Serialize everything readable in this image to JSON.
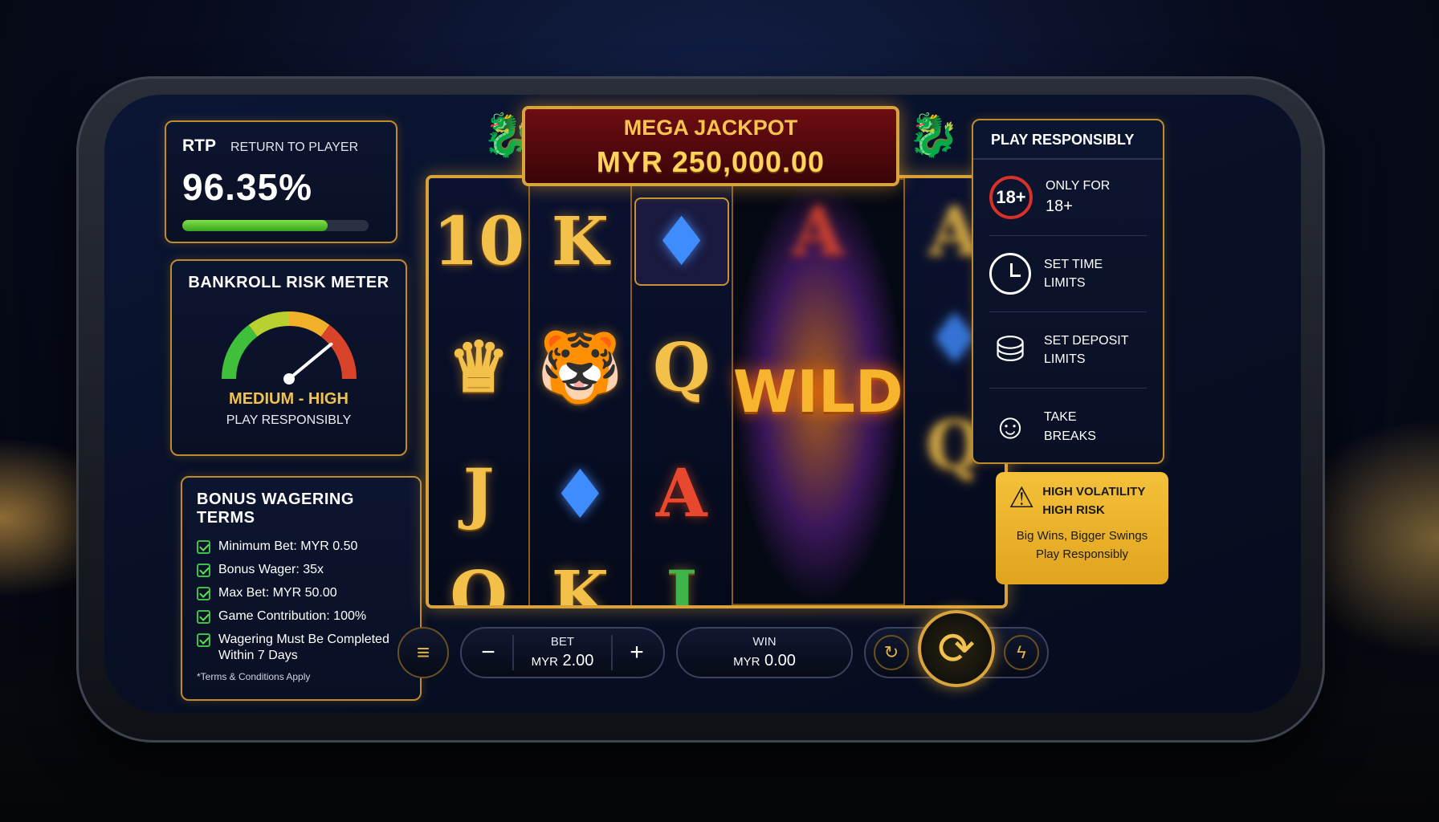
{
  "rtp": {
    "abbr": "RTP",
    "label": "RETURN TO PLAYER",
    "value": "96.35%",
    "bar_fraction": 0.78
  },
  "risk_meter": {
    "title": "BANKROLL RISK METER",
    "level": "MEDIUM - HIGH",
    "note": "PLAY RESPONSIBLY",
    "needle_fraction": 0.78
  },
  "bonus": {
    "title": "BONUS WAGERING TERMS",
    "items": [
      "Minimum Bet: MYR 0.50",
      "Bonus Wager: 35x",
      "Max Bet: MYR 50.00",
      "Game Contribution: 100%",
      "Wagering Must Be Completed Within 7 Days"
    ],
    "terms": "*Terms & Conditions Apply"
  },
  "jackpot": {
    "title": "MEGA JACKPOT",
    "amount": "MYR 250,000.00"
  },
  "reels": {
    "reel1": [
      "10",
      "crown-icon",
      "J",
      "Q"
    ],
    "reel2": [
      "K",
      "tiger-icon",
      "diamond-icon",
      "K"
    ],
    "reel3": [
      "diamond-icon",
      "Q",
      "A",
      "J"
    ],
    "reel4": [
      "A",
      "WILD"
    ],
    "reel5": [
      "A",
      "diamond-icon",
      "Q"
    ]
  },
  "controls": {
    "bet_label": "BET",
    "bet_currency": "MYR",
    "bet_value": "2.00",
    "win_label": "WIN",
    "win_currency": "MYR",
    "win_value": "0.00",
    "minus": "−",
    "plus": "+"
  },
  "responsible": {
    "title": "PLAY RESPONSIBLY",
    "badge": "18+",
    "items": [
      {
        "line1": "ONLY FOR",
        "line2": "18+"
      },
      {
        "line1": "SET TIME",
        "line2": "LIMITS"
      },
      {
        "line1": "SET DEPOSIT",
        "line2": "LIMITS"
      },
      {
        "line1": "TAKE",
        "line2": "BREAKS"
      }
    ]
  },
  "warning": {
    "line1": "HIGH VOLATILITY",
    "line2": "HIGH RISK",
    "body1": "Big Wins, Bigger Swings",
    "body2": "Play Responsibly"
  },
  "colors": {
    "gold": "#f2c14e",
    "accent_red": "#d8312a",
    "warning_yellow": "#f5c13a",
    "rtp_green": "#3aa51c"
  }
}
